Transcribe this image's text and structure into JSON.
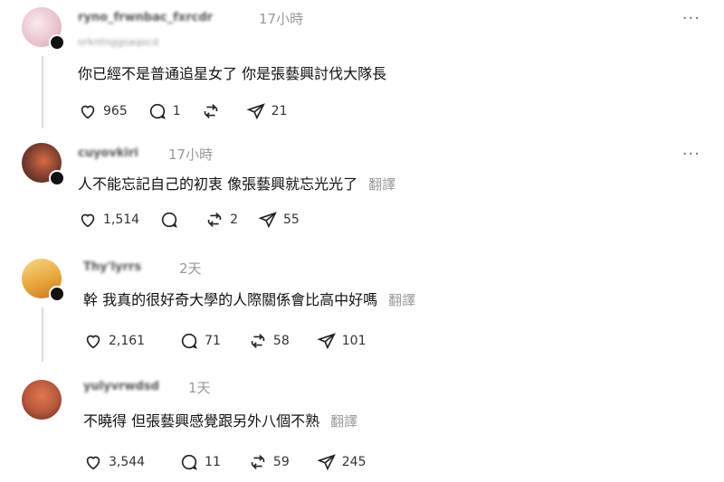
{
  "posts": [
    {
      "username": "ryno_frwnbac_fxrcdr",
      "subhandle": "orkntnggsaqocd",
      "time": "17小時",
      "text": "你已經不是普通追星女了 你是張藝興討伐大隊長",
      "translate": "",
      "likes": "965",
      "replies": "1",
      "reposts": "",
      "shares": "21",
      "avatar_color": "#f1dbe0"
    },
    {
      "username": "cuyovkiri",
      "subhandle": "",
      "time": "17小時",
      "text": "人不能忘記自己的初衷 像張藝興就忘光光了",
      "translate": "翻譯",
      "likes": "1,514",
      "replies": "",
      "reposts": "2",
      "shares": "55",
      "avatar_color": "#7a3c2e"
    },
    {
      "username": "Thy'lyrrs",
      "subhandle": "",
      "time": "2天",
      "text": "幹 我真的很好奇大學的人際關係會比高中好嗎",
      "translate": "翻譯",
      "likes": "2,161",
      "replies": "71",
      "reposts": "58",
      "shares": "101",
      "avatar_color": "#e8b24c"
    },
    {
      "username": "yulyvrwdsd",
      "subhandle": "",
      "time": "1天",
      "text": "不曉得 但張藝興感覺跟另外八個不熟",
      "translate": "翻譯",
      "likes": "3,544",
      "replies": "11",
      "reposts": "59",
      "shares": "245",
      "avatar_color": "#b5563c"
    }
  ],
  "more_label": "···",
  "icons": {
    "like": "heart-icon",
    "reply": "comment-icon",
    "repost": "repost-icon",
    "share": "send-icon"
  },
  "colors": {
    "muted": "#999999",
    "text": "#111111",
    "line": "#dcdcdc"
  }
}
